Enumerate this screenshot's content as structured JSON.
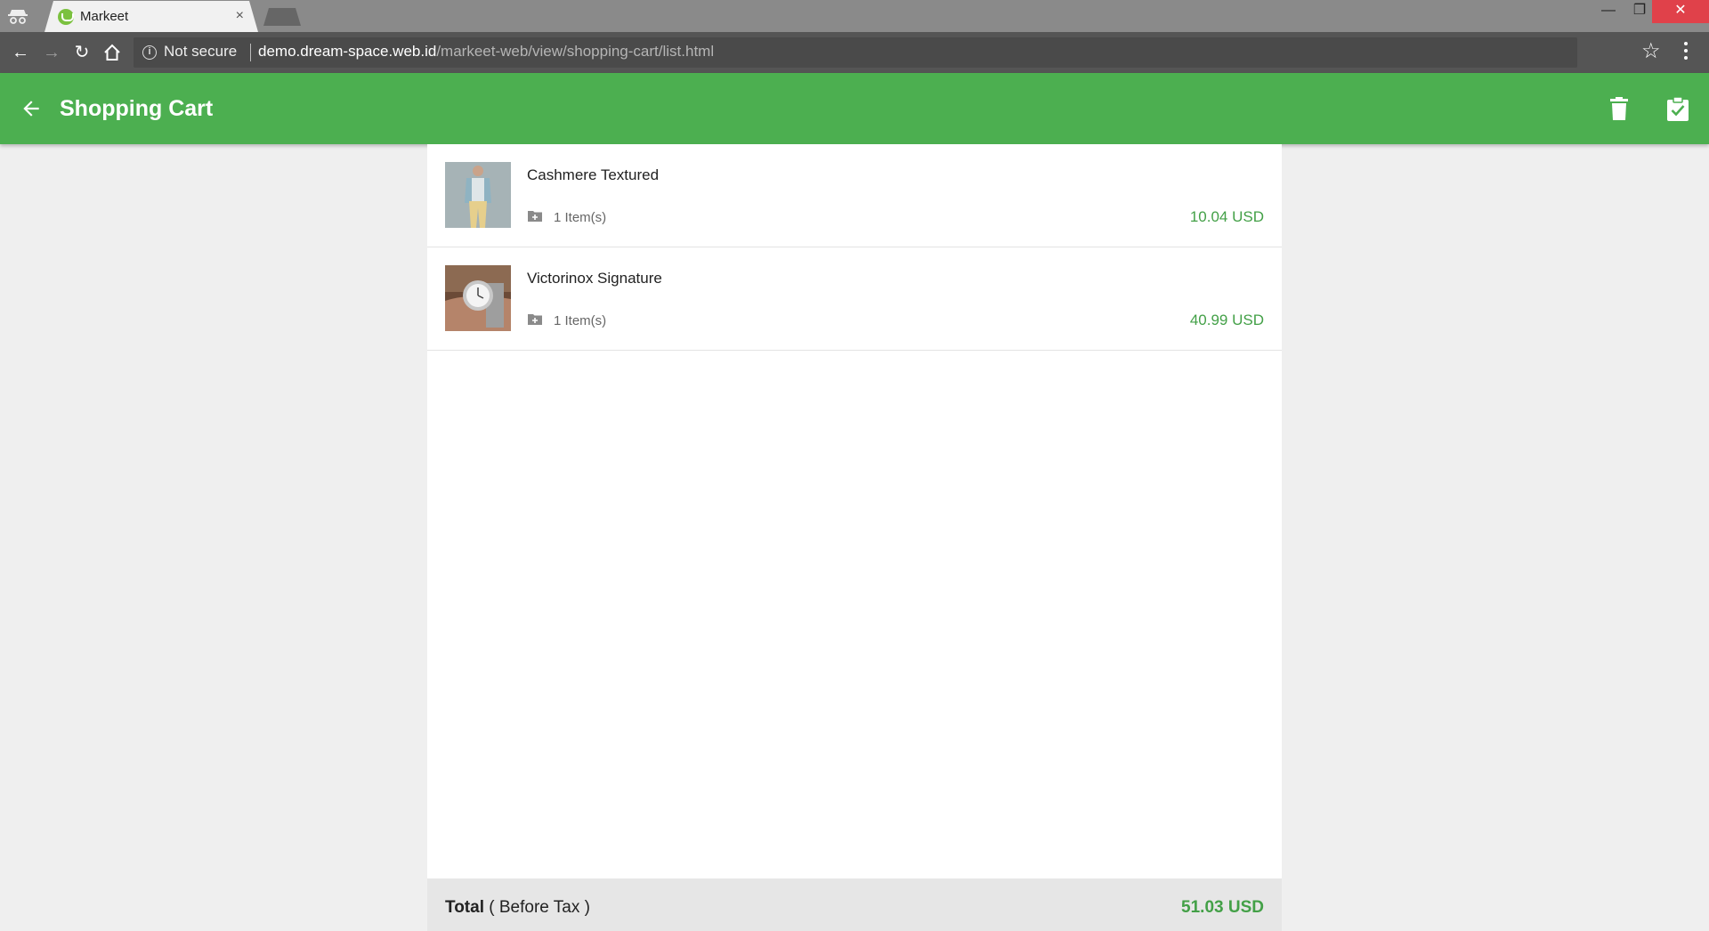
{
  "browser": {
    "tab_title": "Markeet",
    "tab_close": "×",
    "security_text": "Not secure",
    "url_host": "demo.dream-space.web.id",
    "url_path": "/markeet-web/view/shopping-cart/list.html",
    "window_controls": {
      "minimize": "—",
      "maximize": "❐",
      "close": "✕"
    }
  },
  "appbar": {
    "title": "Shopping Cart",
    "color": "#4caf50",
    "icons": [
      "arrow-back-icon",
      "delete-icon",
      "checkout-clipboard-icon"
    ]
  },
  "cart": {
    "items": [
      {
        "name": "Cashmere Textured",
        "quantity": "1 Item(s)",
        "price": "10.04 USD",
        "image": "man-in-cardigan-photo"
      },
      {
        "name": "Victorinox Signature",
        "quantity": "1 Item(s)",
        "price": "40.99 USD",
        "image": "wristwatch-photo"
      }
    ],
    "total_label_bold": "Total",
    "total_label_rest": " ( Before Tax )",
    "total_value": "51.03 USD",
    "price_color": "#43a047"
  }
}
